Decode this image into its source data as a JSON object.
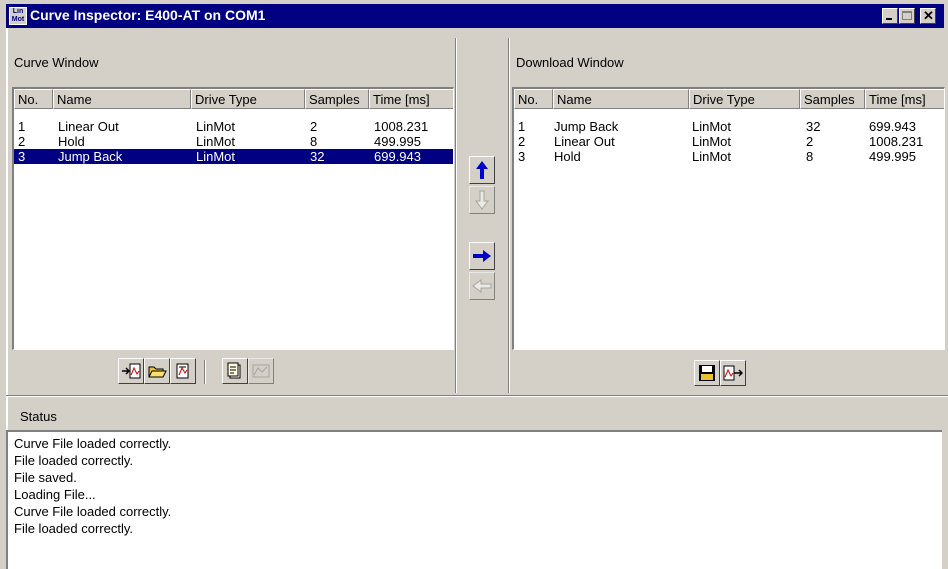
{
  "window": {
    "title": "Curve Inspector: E400-AT on COM1",
    "icon_text_top": "Lin",
    "icon_text_bottom": "Mot"
  },
  "curve_window": {
    "title": "Curve Window",
    "columns": [
      "No.",
      "Name",
      "Drive Type",
      "Samples",
      "Time [ms]"
    ],
    "rows": [
      {
        "no": "1",
        "name": "Linear Out",
        "drive": "LinMot",
        "samples": "2",
        "time": "1008.231",
        "selected": false
      },
      {
        "no": "2",
        "name": "Hold",
        "drive": "LinMot",
        "samples": "8",
        "time": "499.995",
        "selected": false
      },
      {
        "no": "3",
        "name": "Jump Back",
        "drive": "LinMot",
        "samples": "32",
        "time": "699.943",
        "selected": true
      }
    ]
  },
  "download_window": {
    "title": "Download Window",
    "columns": [
      "No.",
      "Name",
      "Drive Type",
      "Samples",
      "Time [ms]"
    ],
    "rows": [
      {
        "no": "1",
        "name": "Jump Back",
        "drive": "LinMot",
        "samples": "32",
        "time": "699.943"
      },
      {
        "no": "2",
        "name": "Linear Out",
        "drive": "LinMot",
        "samples": "2",
        "time": "1008.231"
      },
      {
        "no": "3",
        "name": "Hold",
        "drive": "LinMot",
        "samples": "8",
        "time": "499.995"
      }
    ]
  },
  "status": {
    "title": "Status",
    "lines": [
      "Curve File loaded correctly.",
      "File loaded correctly.",
      "File saved.",
      "Loading File...",
      "Curve File loaded correctly.",
      "File loaded correctly."
    ]
  },
  "colors": {
    "titlebar": "#000080",
    "selection": "#000080",
    "face": "#d4d0c8",
    "arrow_blue": "#0000c8"
  },
  "icons": {
    "move_up": "arrow-up-icon",
    "move_down": "arrow-down-icon",
    "move_right": "arrow-right-icon",
    "move_left": "arrow-left-icon",
    "import_curve": "import-curve-icon",
    "open_file": "open-folder-icon",
    "print": "print-icon",
    "edit_curve": "edit-curve-icon",
    "curve_view": "curve-view-icon",
    "save": "floppy-save-icon",
    "export_curve": "export-curve-icon"
  }
}
